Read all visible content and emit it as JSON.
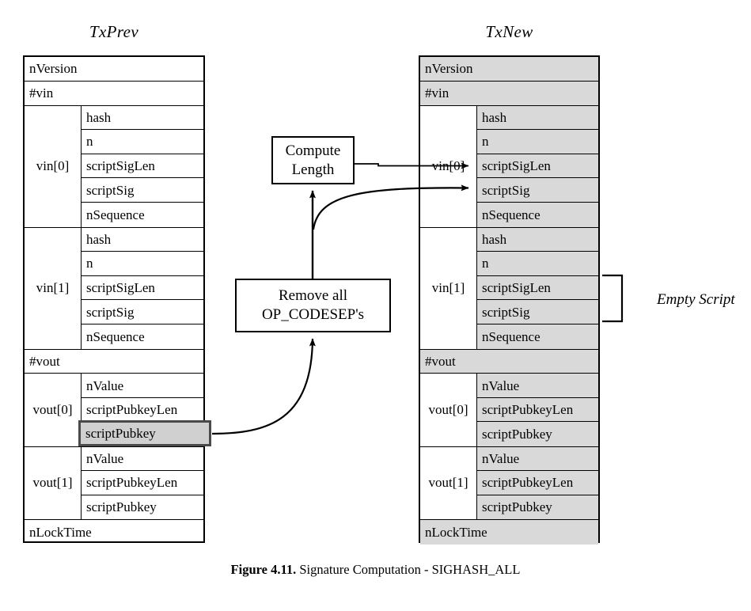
{
  "figure": {
    "label": "Figure 4.11.",
    "caption": "Signature Computation - SIGHASH_ALL"
  },
  "annotations": {
    "empty_script": "Empty Script"
  },
  "process_boxes": [
    {
      "id": "compute-length",
      "line1": "Compute",
      "line2": "Length"
    },
    {
      "id": "remove-opcodesep",
      "line1": "Remove all",
      "line2": "OP_CODESEP's"
    }
  ],
  "colors": {
    "shaded_cell": "#d9d9d9",
    "highlight_fill": "#d0d0d0",
    "highlight_border": "#4a4a4a",
    "line": "#000000",
    "background": "#ffffff"
  },
  "tables": {
    "prev": {
      "title": "TxPrev",
      "rows": {
        "nVersion": "nVersion",
        "nvin": "#vin",
        "nvout": "#vout",
        "nLockTime": "nLockTime"
      },
      "groups": {
        "vin0": {
          "label": "vin[0]",
          "fields": [
            "hash",
            "n",
            "scriptSigLen",
            "scriptSig",
            "nSequence"
          ]
        },
        "vin1": {
          "label": "vin[1]",
          "fields": [
            "hash",
            "n",
            "scriptSigLen",
            "scriptSig",
            "nSequence"
          ]
        },
        "vout0": {
          "label": "vout[0]",
          "fields": [
            "nValue",
            "scriptPubkeyLen",
            "scriptPubkey"
          ]
        },
        "vout1": {
          "label": "vout[1]",
          "fields": [
            "nValue",
            "scriptPubkeyLen",
            "scriptPubkey"
          ]
        }
      },
      "highlighted_cell": "scriptPubkey"
    },
    "new": {
      "title": "TxNew",
      "rows": {
        "nVersion": "nVersion",
        "nvin": "#vin",
        "nvout": "#vout",
        "nLockTime": "nLockTime"
      },
      "groups": {
        "vin0": {
          "label": "vin[0]",
          "fields": [
            "hash",
            "n",
            "scriptSigLen",
            "scriptSig",
            "nSequence"
          ]
        },
        "vin1": {
          "label": "vin[1]",
          "fields": [
            "hash",
            "n",
            "scriptSigLen",
            "scriptSig",
            "nSequence"
          ]
        },
        "vout0": {
          "label": "vout[0]",
          "fields": [
            "nValue",
            "scriptPubkeyLen",
            "scriptPubkey"
          ]
        },
        "vout1": {
          "label": "vout[1]",
          "fields": [
            "nValue",
            "scriptPubkeyLen",
            "scriptPubkey"
          ]
        }
      }
    }
  }
}
